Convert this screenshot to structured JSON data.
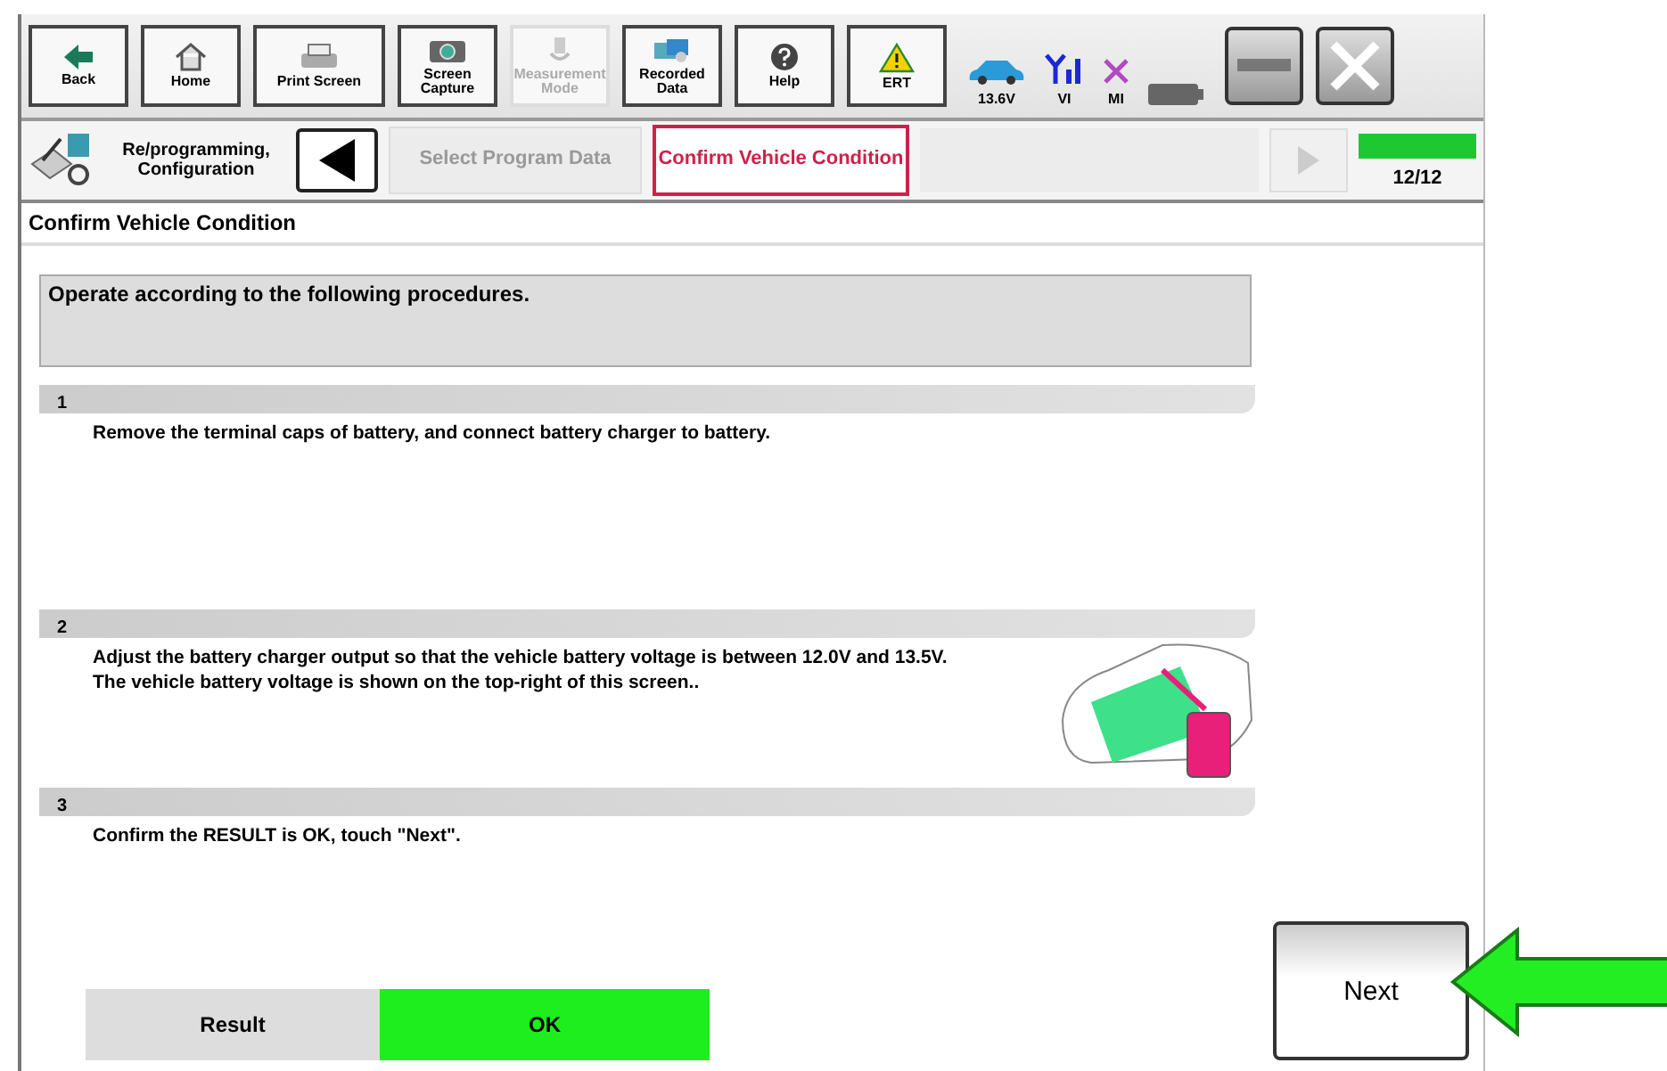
{
  "toolbar": {
    "buttons": [
      {
        "label": "Back",
        "kind": "back",
        "disabled": false
      },
      {
        "label": "Home",
        "kind": "home",
        "disabled": false
      },
      {
        "label": "Print Screen",
        "kind": "print",
        "disabled": false
      },
      {
        "label": "Screen Capture",
        "kind": "camera",
        "disabled": false
      },
      {
        "label": "Measurement Mode",
        "kind": "probe",
        "disabled": true
      },
      {
        "label": "Recorded Data",
        "kind": "data",
        "disabled": false
      },
      {
        "label": "Help",
        "kind": "help",
        "disabled": false
      },
      {
        "label": "ERT",
        "kind": "warning",
        "disabled": false
      }
    ],
    "status": [
      {
        "label": "13.6V",
        "kind": "car"
      },
      {
        "label": "VI",
        "kind": "signal"
      },
      {
        "label": "MI",
        "kind": "cross"
      },
      {
        "kind": "battery"
      }
    ]
  },
  "breadcrumb": {
    "section": "Re/programming, Configuration",
    "back_disabled": false,
    "steps": [
      {
        "label": "Select Program Data",
        "selected": false
      },
      {
        "label": "Confirm Vehicle Condition",
        "selected": true
      }
    ],
    "forward_disabled": true,
    "progress": {
      "level": 1,
      "label": "12/12"
    }
  },
  "page_title": "Confirm Vehicle Condition",
  "instruction": "Operate according to the following procedures.",
  "steps": [
    {
      "number": "1",
      "text": "Remove the terminal caps of battery, and connect battery charger to battery."
    },
    {
      "number": "2",
      "text": "Adjust the battery charger output so that the vehicle battery voltage is between 12.0V and 13.5V. The vehicle battery voltage is shown on the top-right of this screen..",
      "illustration": true
    },
    {
      "number": "3",
      "text": "Confirm the RESULT is OK, touch \"Next\"."
    }
  ],
  "result": {
    "label": "Result",
    "value": "OK",
    "ok": true
  },
  "next_button": "Next",
  "callout_arrow": true
}
